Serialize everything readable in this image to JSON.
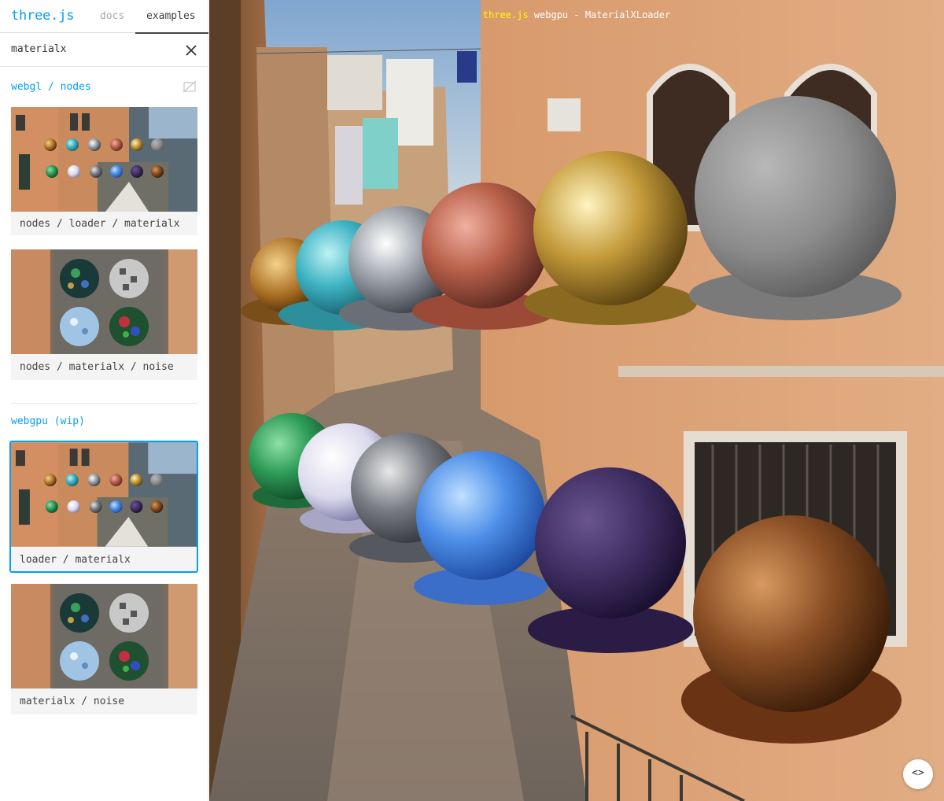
{
  "sidebar": {
    "brand": "three.js",
    "tabs": {
      "docs": "docs",
      "examples": "examples"
    },
    "search": {
      "value": "materialx"
    },
    "categories": [
      {
        "title": "webgl / nodes"
      },
      {
        "title": "webgpu (wip)"
      }
    ],
    "examples": [
      {
        "label": "nodes / loader / materialx",
        "selected": false
      },
      {
        "label": "nodes / materialx / noise",
        "selected": false
      },
      {
        "label": "loader / materialx",
        "selected": true
      },
      {
        "label": "materialx / noise",
        "selected": false
      }
    ]
  },
  "viewport": {
    "title_brand": "three.js",
    "title_rest": " webgpu - MaterialXLoader",
    "view_source": "<>"
  },
  "icons": {
    "clear": "close-icon",
    "webgpu_unsupported": "no-webgpu-icon",
    "view_source": "code-icon"
  },
  "colors": {
    "accent": "#049ef4",
    "title_highlight": "#ffff00"
  }
}
